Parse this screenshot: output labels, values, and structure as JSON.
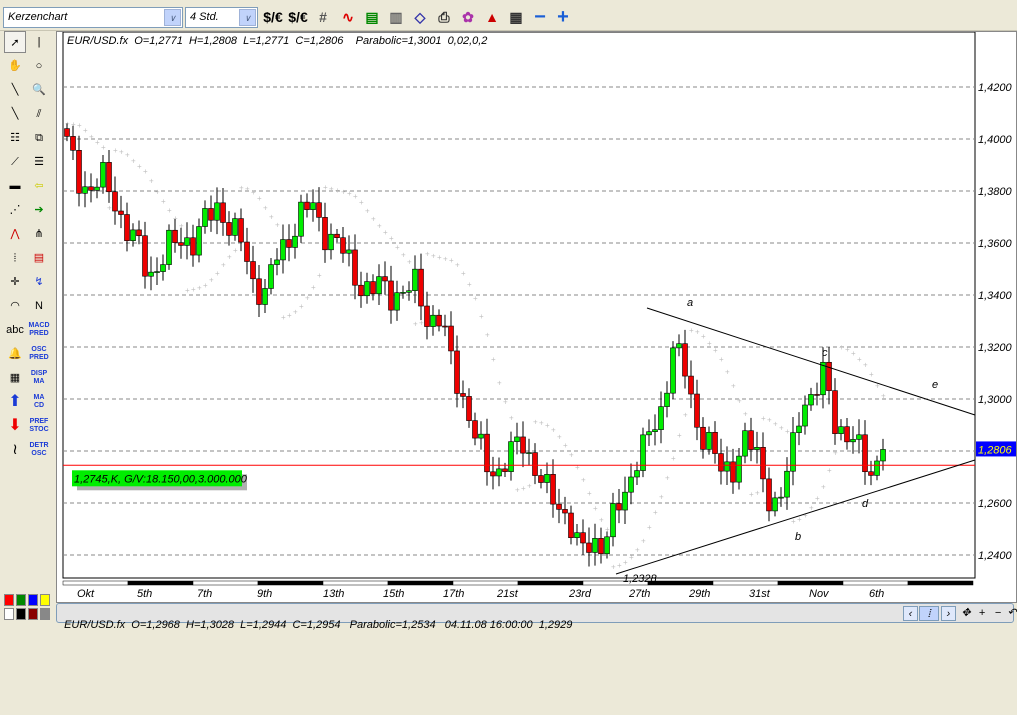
{
  "toolbar": {
    "chart_type": "Kerzenchart",
    "timeframe": "4 Std.",
    "icons": [
      "dollar-euro-icon",
      "dollar-euro-alt-icon",
      "grid-icon",
      "indicator-wave-icon",
      "indicator-panel-icon",
      "data-window-icon",
      "eraser-icon",
      "print-icon",
      "color-icon",
      "alert-icon",
      "settings-icon",
      "zoom-out-icon",
      "zoom-in-icon"
    ]
  },
  "sidebar": {
    "text_tools": [
      "abc",
      "MACD PRED",
      "OSC PRED",
      "DISP MA",
      "MA CD",
      "PREF STOC",
      "DETR OSC"
    ]
  },
  "chart_header": "EUR/USD.fx  O=1,2771  H=1,2808  L=1,2771  C=1,2806    Parabolic=1,3001  0,02,0,2",
  "status_bar": "EUR/USD.fx  O=1,2968  H=1,3028  L=1,2944  C=1,2954   Parabolic=1,2534   04.11.08 16:00:00  1,2929",
  "order_label": "1,2745,K, G/V:18.150,00,3.000.000",
  "current_price": "1,2806",
  "low_label": "1,2328",
  "wave_labels": [
    "a",
    "b",
    "c",
    "d",
    "e"
  ],
  "colors": {
    "up": "#00ee00",
    "down": "#ee0000",
    "order_line": "#ff0000",
    "price_badge": "#0000ff",
    "sar": "#c0c0c0"
  },
  "chart_data": {
    "type": "candlestick",
    "symbol": "EUR/USD.fx",
    "ylim": [
      1.232,
      1.441
    ],
    "y_ticks": [
      "1,4200",
      "1,4000",
      "1,3800",
      "1,3600",
      "1,3400",
      "1,3200",
      "1,3000",
      "1,2800",
      "1,2600",
      "1,2400"
    ],
    "y_tick_values": [
      1.42,
      1.4,
      1.38,
      1.36,
      1.34,
      1.32,
      1.3,
      1.28,
      1.26,
      1.24
    ],
    "x_ticks": [
      "Okt",
      "5th",
      "7th",
      "9th",
      "13th",
      "15th",
      "17th",
      "21st",
      "23rd",
      "27th",
      "29th",
      "31st",
      "Nov",
      "6th"
    ],
    "x_tick_bar": [
      2,
      12,
      22,
      32,
      43,
      53,
      63,
      72,
      84,
      94,
      104,
      114,
      124,
      134
    ],
    "close_waypoints": [
      1.398,
      1.385,
      1.38,
      1.385,
      1.378,
      1.365,
      1.36,
      1.348,
      1.352,
      1.36,
      1.362,
      1.36,
      1.37,
      1.375,
      1.365,
      1.36,
      1.345,
      1.34,
      1.355,
      1.362,
      1.37,
      1.375,
      1.365,
      1.36,
      1.355,
      1.345,
      1.34,
      1.345,
      1.34,
      1.34,
      1.345,
      1.33,
      1.33,
      1.315,
      1.3,
      1.285,
      1.275,
      1.272,
      1.278,
      1.285,
      1.275,
      1.265,
      1.26,
      1.255,
      1.24,
      1.245,
      1.245,
      1.255,
      1.265,
      1.28,
      1.285,
      1.295,
      1.322,
      1.31,
      1.29,
      1.285,
      1.272,
      1.272,
      1.285,
      1.28,
      1.265,
      1.258,
      1.275,
      1.3,
      1.3,
      1.31,
      1.29,
      1.285,
      1.28,
      1.272,
      1.2806
    ],
    "bars": 137,
    "order_level": 1.2745,
    "trendlines": [
      {
        "name": "upper",
        "from": [
          1.334,
          "a-1"
        ],
        "to": [
          1.292,
          "end"
        ]
      },
      {
        "name": "lower",
        "from": [
          1.2328,
          "low"
        ],
        "to": [
          1.2768,
          "end"
        ]
      }
    ],
    "parabolic_sar": {
      "step": 0.02,
      "max": 0.2
    }
  }
}
